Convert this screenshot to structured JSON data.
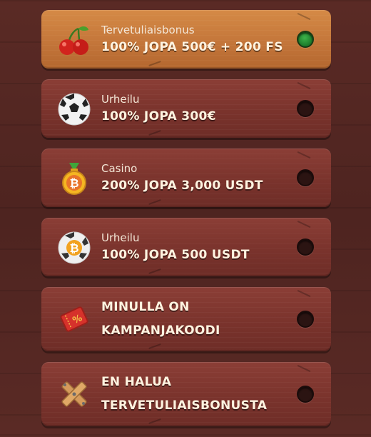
{
  "options": [
    {
      "category": "Tervetuliaisbonus",
      "title": "100% JOPA 500€ + 200 FS",
      "icon": "cherry-icon",
      "selected": true
    },
    {
      "category": "Urheilu",
      "title": "100% JOPA 300€",
      "icon": "soccer-ball-icon",
      "selected": false
    },
    {
      "category": "Casino",
      "title": "200% JOPA 3,000 USDT",
      "icon": "bitcoin-medal-icon",
      "selected": false
    },
    {
      "category": "Urheilu",
      "title": "100% JOPA 500 USDT",
      "icon": "bitcoin-ball-icon",
      "selected": false
    },
    {
      "category": "",
      "title_line1": "MINULLA ON",
      "title_line2": "KAMPANJAKOODI",
      "icon": "promo-ticket-icon",
      "selected": false
    },
    {
      "category": "",
      "title_line1": "EN HALUA",
      "title_line2": "TERVETULIAISBONUSTA",
      "icon": "cross-plank-icon",
      "selected": false
    }
  ],
  "colors": {
    "selected_card": "#c4763a",
    "card": "#7a332c",
    "background": "#4e2420",
    "radio_on": "#2e9a3c"
  }
}
